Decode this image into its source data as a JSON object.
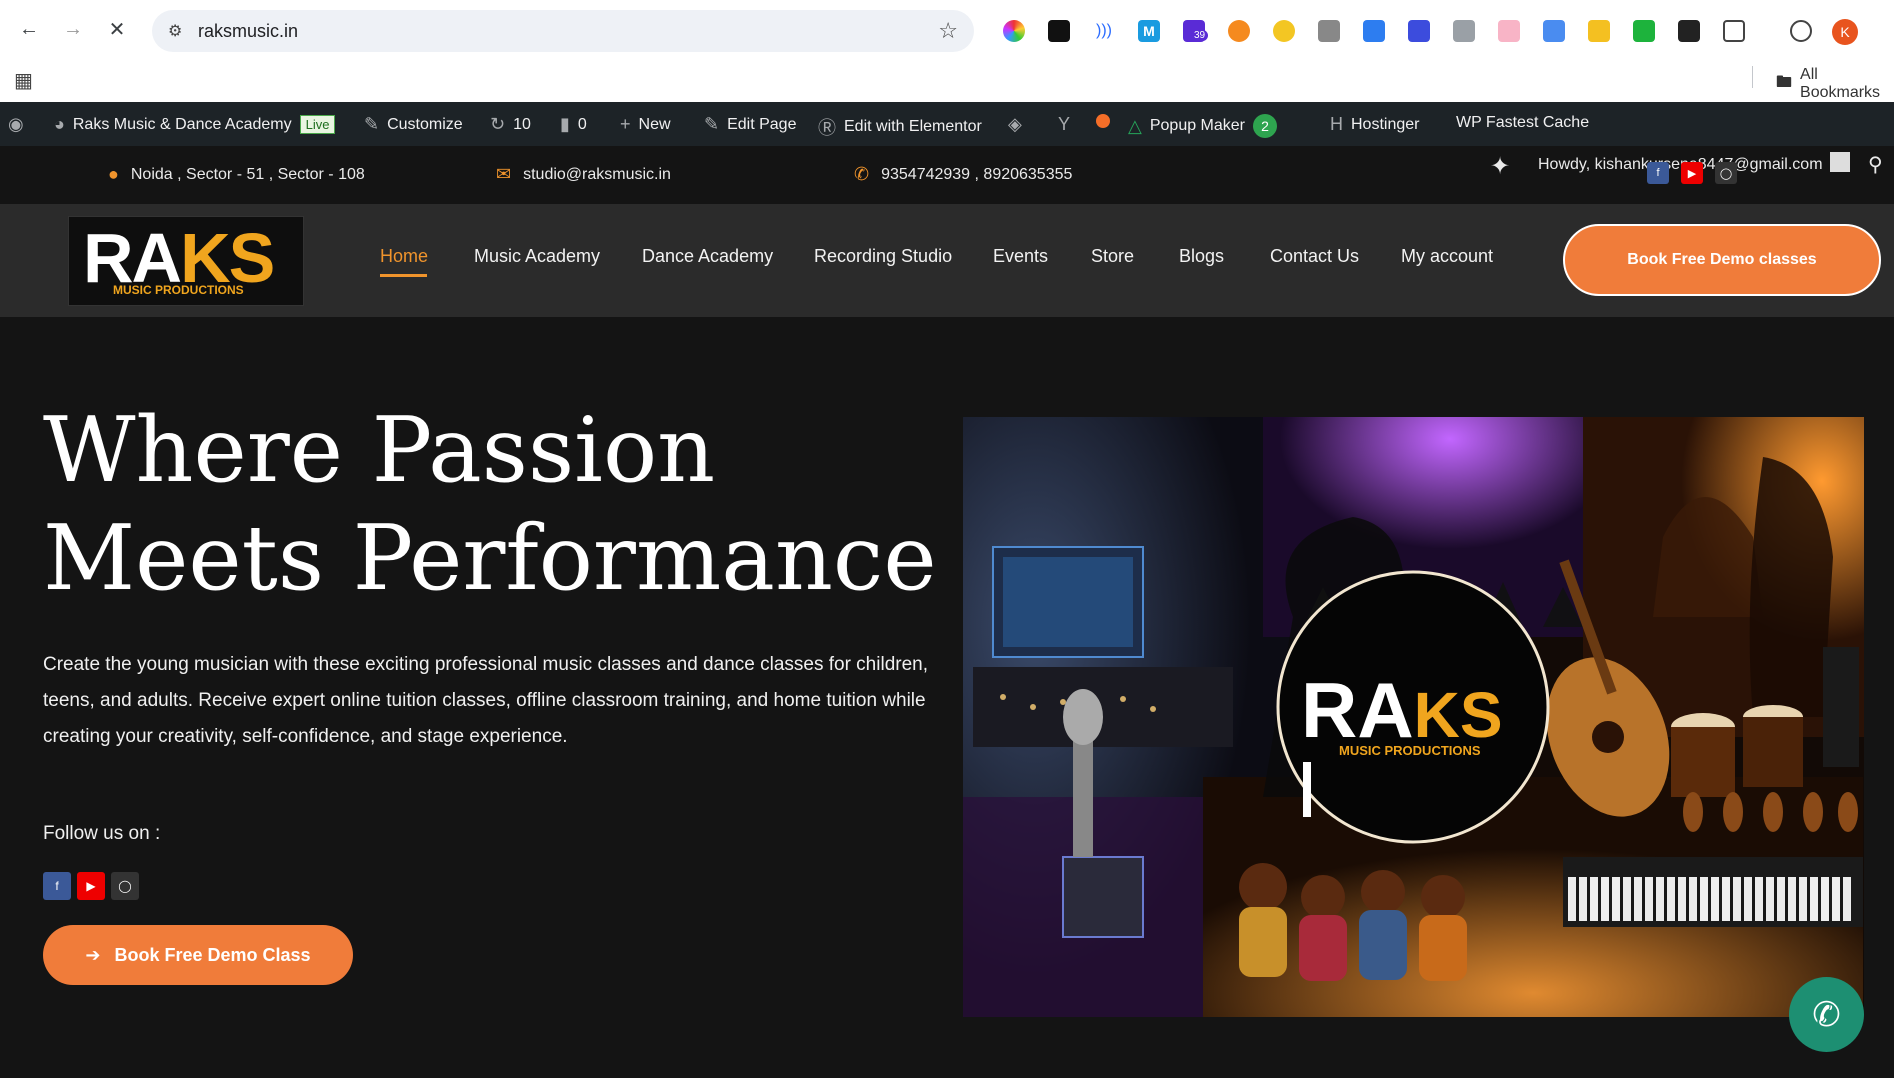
{
  "browser": {
    "url": "raksmusic.in",
    "bookmarks_label": "All Bookmarks",
    "profile_initial": "K",
    "extension_badge": "39"
  },
  "wp_admin_bar": {
    "site_name": "Raks Music & Dance Academy",
    "live_badge": "Live",
    "customize": "Customize",
    "updates_count": "10",
    "comments_count": "0",
    "new": "New",
    "edit_page": "Edit Page",
    "edit_elementor": "Edit with Elementor",
    "popup_maker": "Popup Maker",
    "popup_count": "2",
    "alert": "!",
    "hostinger": "Hostinger",
    "wp_fastest_cache": "WP Fastest Cache",
    "howdy": "Howdy, kishankursena8447@gmail.com"
  },
  "contact_bar": {
    "address": "Noida , Sector - 51 , Sector - 108",
    "email": "studio@raksmusic.in",
    "phone": "9354742939 , 8920635355"
  },
  "header": {
    "logo_main_white": "RA",
    "logo_main_orange": "KS",
    "logo_sub": "MUSIC PRODUCTIONS",
    "menu": [
      "Home",
      "Music Academy",
      "Dance Academy",
      "Recording Studio",
      "Events",
      "Store",
      "Blogs",
      "Contact Us",
      "My account"
    ],
    "cta": "Book Free Demo classes"
  },
  "hero": {
    "title": "Where Passion Meets Performance",
    "body": "Create the young musician with these exciting professional music classes and dance classes for children, teens, and adults. Receive expert online tuition classes, offline classroom training, and home tuition while creating your creativity, self-confidence, and stage experience.",
    "follow": "Follow us on :",
    "cta": "Book Free Demo Class",
    "image_logo_white": "RA",
    "image_logo_orange": "KS",
    "image_logo_sub": "MUSIC PRODUCTIONS"
  },
  "colors": {
    "accent": "#f07c3a",
    "menu_active": "#f0942c",
    "background": "#141414",
    "header": "#2b2b2b",
    "wp_bar": "#1d2327"
  }
}
